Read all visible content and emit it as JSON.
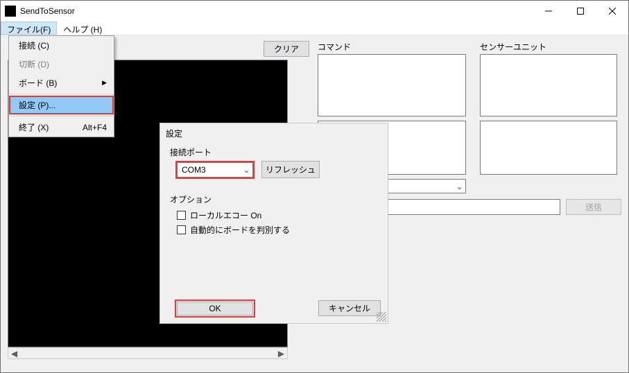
{
  "window": {
    "title": "SendToSensor"
  },
  "menubar": {
    "file": "ファイル(F)",
    "help": "ヘルプ (H)"
  },
  "fileMenu": {
    "connect": "接続 (C)",
    "disconnect": "切断 (D)",
    "board": "ボード (B)",
    "board_arrow": "▶",
    "settings": "設定 (P)...",
    "exit": "終了 (X)",
    "exit_accel": "Alt+F4"
  },
  "main": {
    "clear_label": "クリア",
    "command_label": "コマンド",
    "sensor_label": "センサーユニット",
    "send_label": "送信"
  },
  "dialog": {
    "title": "設定",
    "port_group": "接続ポート",
    "port_value": "COM3",
    "refresh_label": "リフレッシュ",
    "options_group": "オプション",
    "opt_echo": "ローカルエコー On",
    "opt_auto": "自動的にボードを判別する",
    "ok": "OK",
    "cancel": "キャンセル"
  },
  "glyph": {
    "chevron_down": "⌄",
    "tri_left": "◀",
    "tri_right": "▶"
  }
}
